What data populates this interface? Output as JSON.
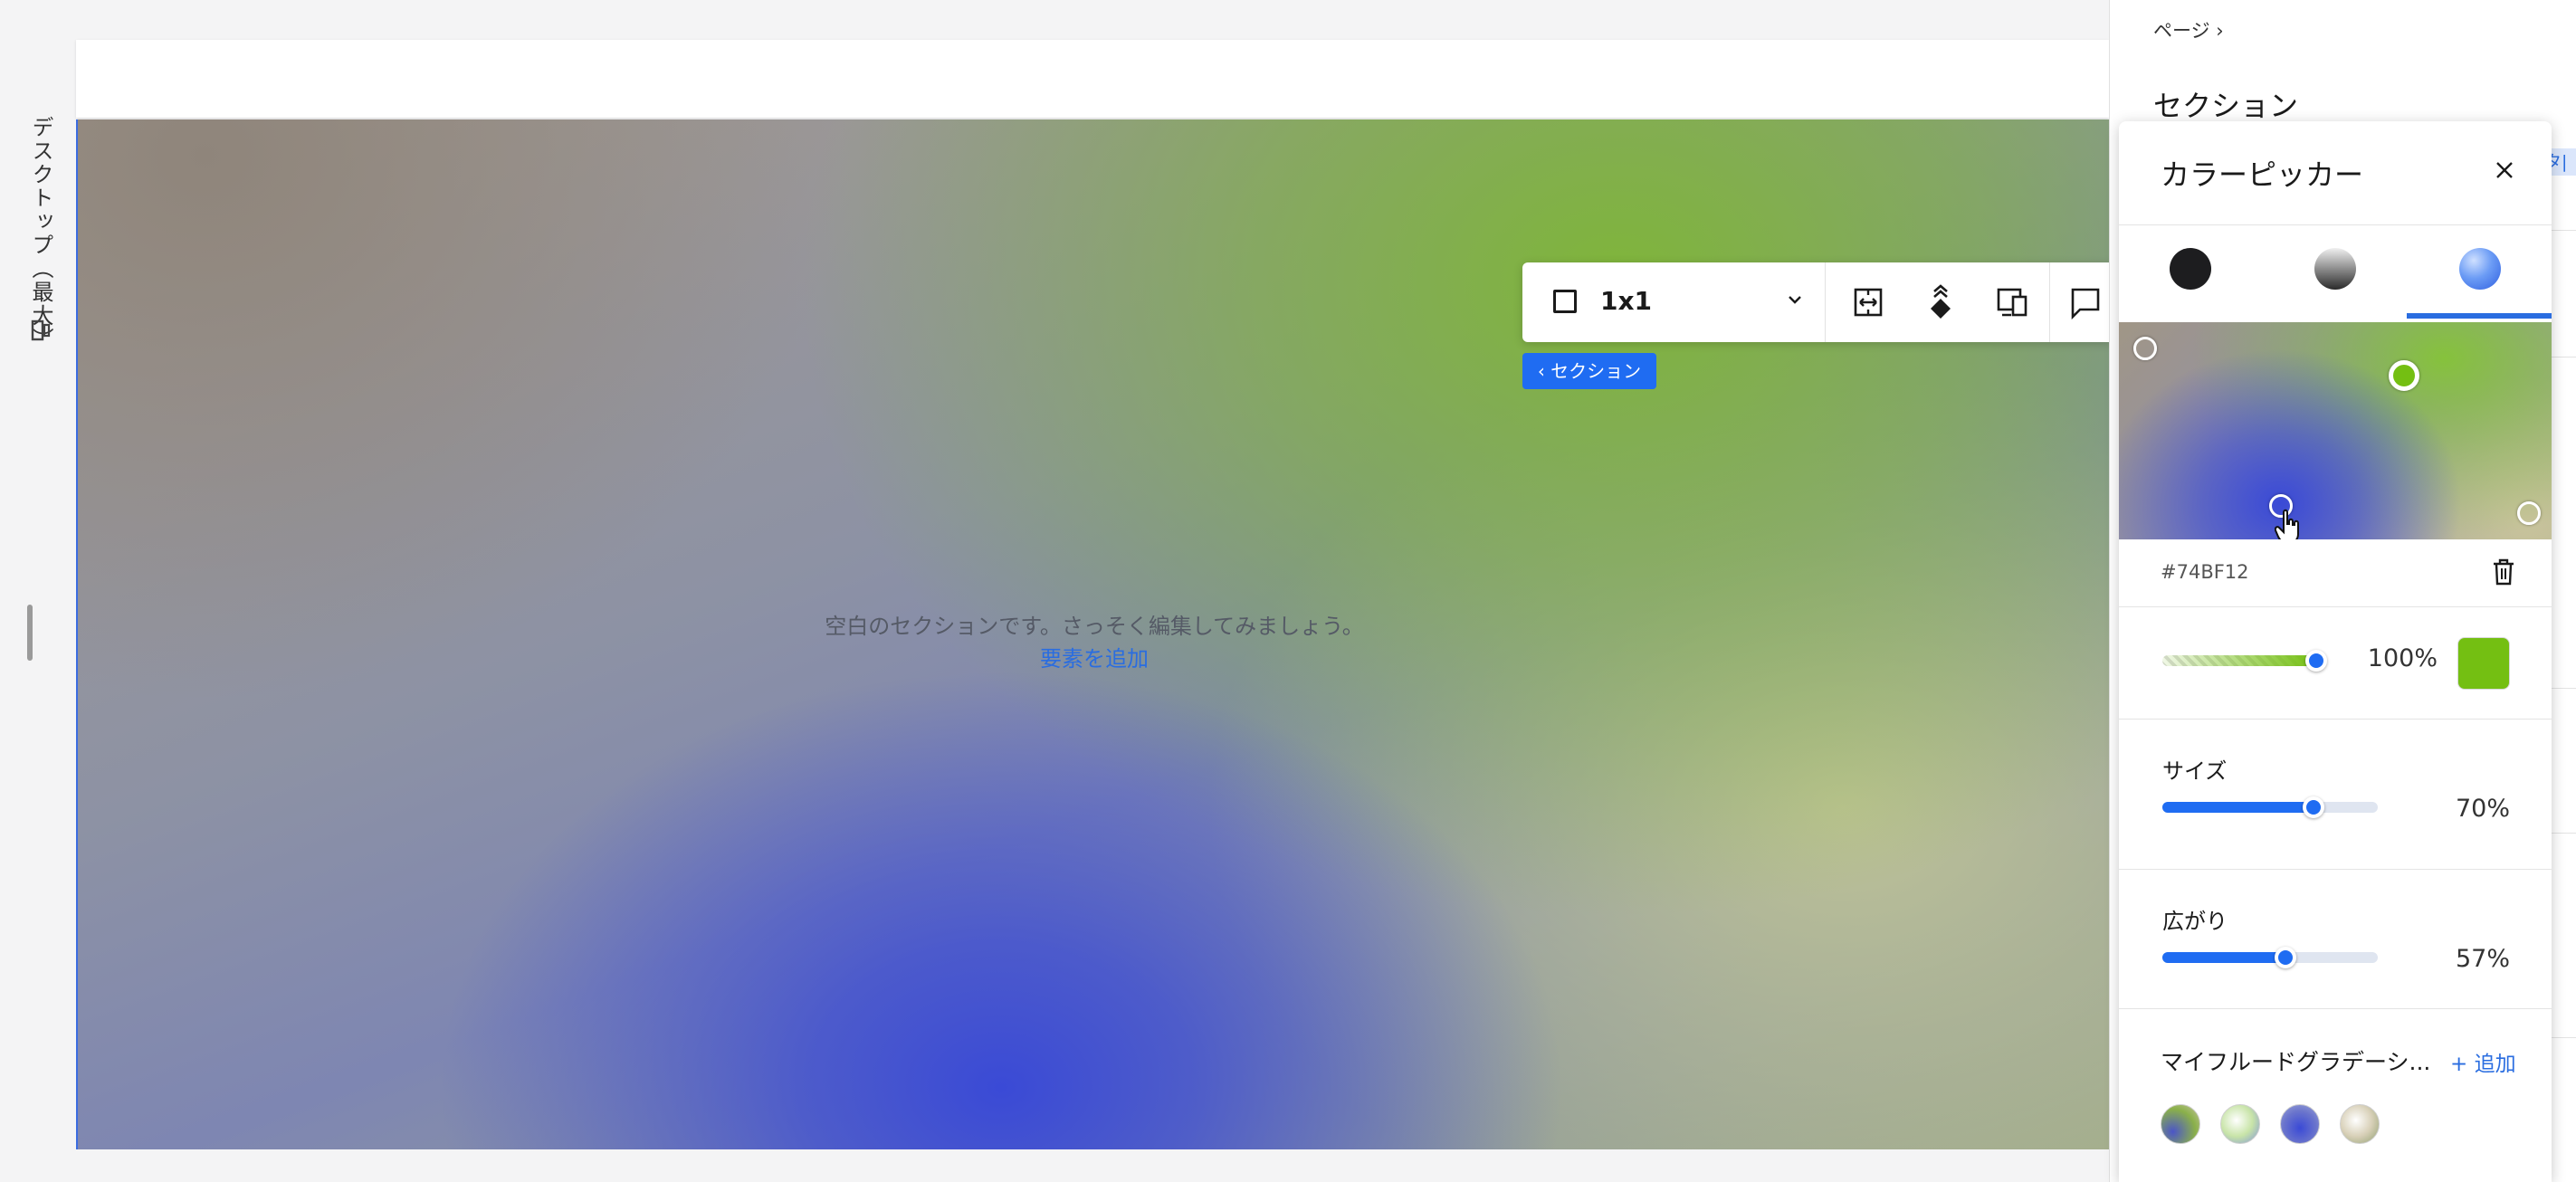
{
  "rail": {
    "device_label": "デスクトップ（最大）"
  },
  "canvas": {
    "empty_message": "空白のセクションです。さっそく編集してみましょう。",
    "add_element_link": "要素を追加"
  },
  "toolbar": {
    "layout_ratio": "1x1"
  },
  "section_tag": "‹ セクション",
  "inspector": {
    "breadcrumb": "ページ  ›",
    "title": "セクション",
    "tab_edge_text": "タ|"
  },
  "color_picker": {
    "title": "カラーピッカー",
    "tabs": [
      "solid-color",
      "linear-gradient",
      "fluid-gradient"
    ],
    "selected_tab": "fluid-gradient",
    "selected_point_color": "#74BF12",
    "hex_value": "#74BF12",
    "opacity": {
      "value": "100",
      "unit": "%",
      "level": 1.0
    },
    "size": {
      "label": "サイズ",
      "value": "70",
      "unit": "%",
      "level": 0.7
    },
    "spread": {
      "label": "広がり",
      "value": "57",
      "unit": "%",
      "level": 0.57
    },
    "my_fluid_gradients": {
      "title": "マイフルードグラデーシ...",
      "add_label": "+ 追加",
      "swatch_count": 4
    }
  },
  "colors": {
    "accent": "#1F6CF2",
    "link": "#2A6DE0",
    "gradient_blue": "#3A4AD6",
    "gradient_green": "#74BF12"
  }
}
